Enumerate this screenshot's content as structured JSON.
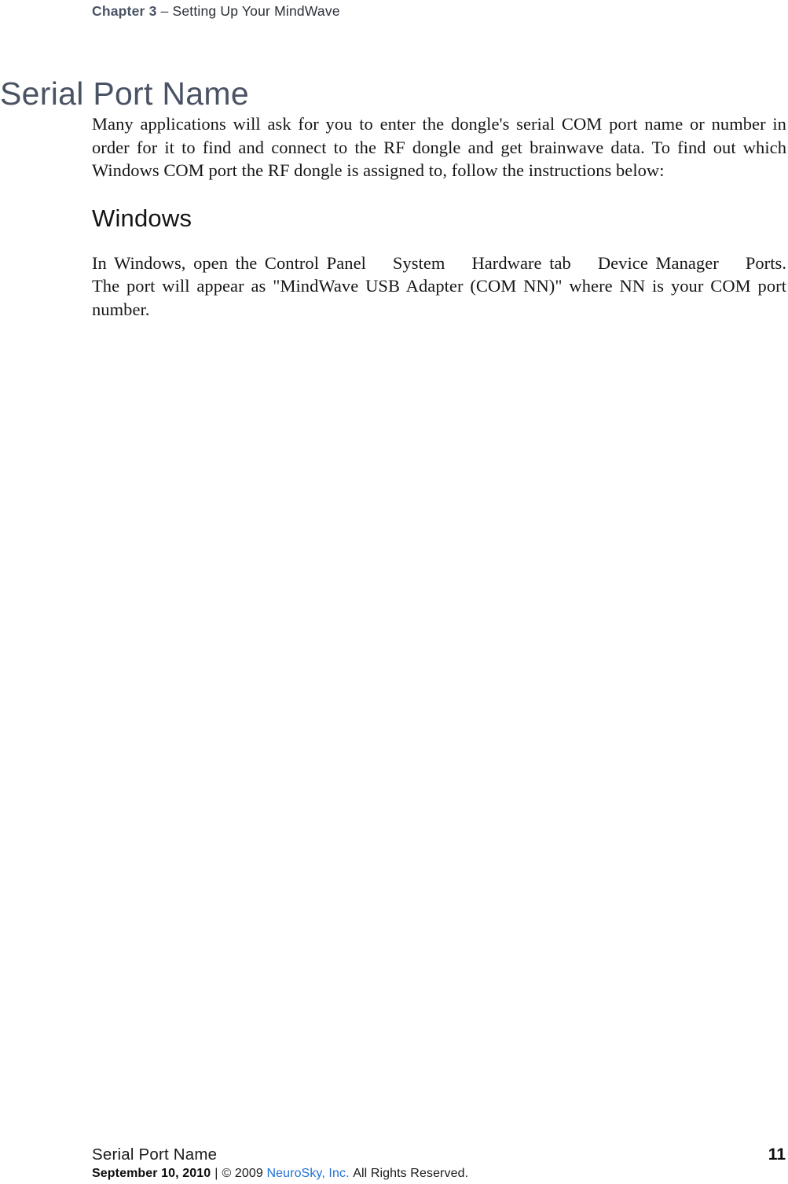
{
  "header": {
    "chapter_label": "Chapter 3",
    "separator": "–",
    "chapter_title": "Setting Up Your MindWave"
  },
  "page_title": "Serial Port Name",
  "content": {
    "intro_paragraph": "Many applications will ask for you to enter the dongle's serial COM port name or number in order for it to find and connect to the RF dongle and get brainwave data.  To find out which Windows COM port the RF dongle is assigned to, follow the instructions below:",
    "sub_heading": "Windows",
    "windows_paragraph": {
      "segment_1": "In Windows, open the Control Panel",
      "segment_2": "System",
      "segment_3": "Hardware tab",
      "segment_4": "Device Manager",
      "segment_5": "Ports.  The port will appear as \"MindWave USB Adapter (COM NN)\" where NN is your COM port number."
    }
  },
  "footer": {
    "section_name": "Serial Port Name",
    "page_number": "11",
    "date": "September 10, 2010",
    "pipe": "|",
    "copyright": "© 2009",
    "company_link": "NeuroSky, Inc.",
    "rights": "All Rights Reserved."
  },
  "colors": {
    "heading_slate": "#4a5364",
    "body_black": "#161616",
    "link_blue": "#2171d6",
    "page_background": "#ffffff"
  }
}
